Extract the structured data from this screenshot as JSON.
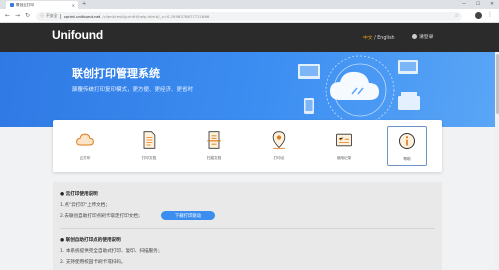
{
  "browser": {
    "tab_title": "联创云打印",
    "url_security": "不安全",
    "url_host": "cprint.unifound.net",
    "url_path": "/client/revit/printH/help.htm#/_v=0.2956378877721666"
  },
  "header": {
    "logo_text": "Unifound",
    "lang_cn": "中文",
    "lang_sep": " / ",
    "lang_en": "English",
    "login": "请登录"
  },
  "banner": {
    "title": "联创打印管理系统",
    "subtitle": "颠覆传统打印复印模式，更方便、更经济、更省时"
  },
  "features": [
    {
      "label": "云打印",
      "icon": "cloud-icon"
    },
    {
      "label": "打印文档",
      "icon": "document-icon"
    },
    {
      "label": "扫描文档",
      "icon": "scan-document-icon"
    },
    {
      "label": "打印点",
      "icon": "location-pin-icon"
    },
    {
      "label": "使用记录",
      "icon": "records-icon"
    },
    {
      "label": "帮助",
      "icon": "info-icon"
    }
  ],
  "help": {
    "section1_title": "● 云打印使用说明",
    "section1_line1": "1.点\"云打印\"上传文档；",
    "section1_line2": "2.去联创自助打印点刷卡取走打印文档；",
    "download_button": "下载打印驱动",
    "section2_title": "● 联创自助打印点的使用说明",
    "section2_line1": "1. 本系统提供完全自助式打印、复印、扫描服务；",
    "section2_line2": "2. 支持使用校园卡刷卡或扫码。"
  },
  "colors": {
    "header_bg": "#2b2b2b",
    "banner_bg": "#3d8ff2",
    "accent": "#f19a1d",
    "button": "#3b8ef0"
  }
}
